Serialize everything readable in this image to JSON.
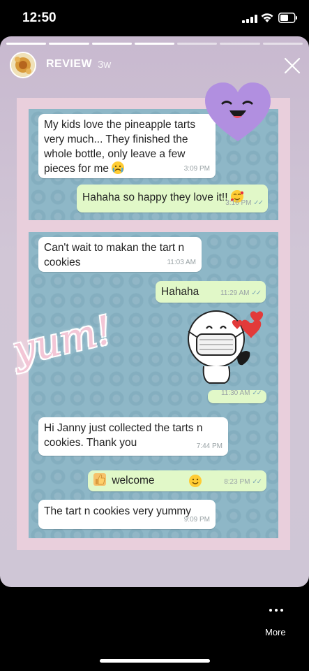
{
  "status_bar": {
    "time": "12:50"
  },
  "story": {
    "username": "REVIEW",
    "age": "3w",
    "progress": {
      "segments": 7,
      "completed": 4
    }
  },
  "chat1": {
    "messages": [
      {
        "direction": "in",
        "text_lines": [
          "My kids love the pineapple tarts",
          "very much... They finished the",
          "whole bottle, only leave a few",
          "pieces for me"
        ],
        "emoji": "crying-face",
        "time": "3:09 PM"
      },
      {
        "direction": "out",
        "text": "Hahaha so happy they love it!!",
        "emoji": "smiling-face-with-hearts",
        "time": "3:16 PM"
      }
    ]
  },
  "chat2": {
    "messages": [
      {
        "direction": "in",
        "text_lines": [
          "Can't wait to makan the tart n",
          "cookies"
        ],
        "time": "11:03 AM"
      },
      {
        "direction": "out",
        "text": "Hahaha",
        "time": "11:29 AM"
      },
      {
        "direction": "out",
        "type": "sticker",
        "time": "11:30 AM"
      },
      {
        "direction": "in",
        "text_lines": [
          "Hi Janny just collected the tarts n",
          "cookies. Thank you"
        ],
        "time": "7:44 PM"
      },
      {
        "direction": "out",
        "text": "welcome",
        "emoji_before": "thumbs-up",
        "emoji_after": "smiling-face",
        "time": "8:23 PM"
      },
      {
        "direction": "in",
        "text": "The tart n cookies very yummy",
        "time": "9:09 PM"
      }
    ]
  },
  "decorations": {
    "yum_text": "yum!"
  },
  "bottom": {
    "more_label": "More"
  },
  "colors": {
    "incoming": "#ffffff",
    "outgoing": "#e1f8c8",
    "chat_bg": "#8eb7c7",
    "frame": "#e9cfdc"
  }
}
